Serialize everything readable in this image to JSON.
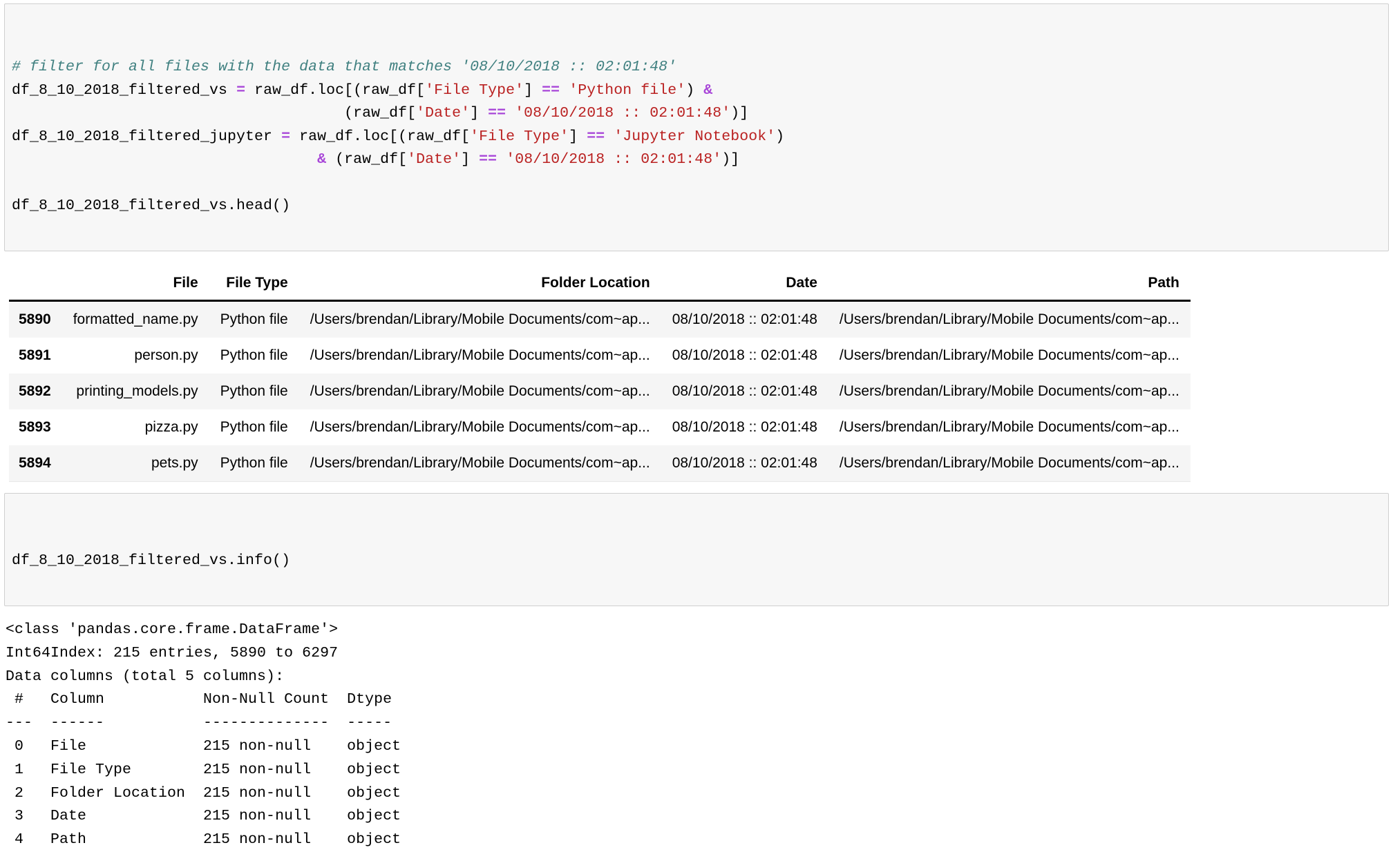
{
  "cell_1": {
    "name": "filter-code-cell",
    "lines": [
      [
        {
          "t": "comment",
          "v": "# filter for all files with the data that matches '08/10/2018 :: 02:01:48'"
        }
      ],
      [
        {
          "t": "plain",
          "v": "df_8_10_2018_filtered_vs "
        },
        {
          "t": "op",
          "v": "="
        },
        {
          "t": "plain",
          "v": " raw_df.loc[(raw_df["
        },
        {
          "t": "string",
          "v": "'File Type'"
        },
        {
          "t": "plain",
          "v": "] "
        },
        {
          "t": "op",
          "v": "=="
        },
        {
          "t": "plain",
          "v": " "
        },
        {
          "t": "string",
          "v": "'Python file'"
        },
        {
          "t": "plain",
          "v": ") "
        },
        {
          "t": "op",
          "v": "&"
        }
      ],
      [
        {
          "t": "plain",
          "v": "                                     (raw_df["
        },
        {
          "t": "string",
          "v": "'Date'"
        },
        {
          "t": "plain",
          "v": "] "
        },
        {
          "t": "op",
          "v": "=="
        },
        {
          "t": "plain",
          "v": " "
        },
        {
          "t": "string",
          "v": "'08/10/2018 :: 02:01:48'"
        },
        {
          "t": "plain",
          "v": ")]"
        }
      ],
      [
        {
          "t": "plain",
          "v": "df_8_10_2018_filtered_jupyter "
        },
        {
          "t": "op",
          "v": "="
        },
        {
          "t": "plain",
          "v": " raw_df.loc[(raw_df["
        },
        {
          "t": "string",
          "v": "'File Type'"
        },
        {
          "t": "plain",
          "v": "] "
        },
        {
          "t": "op",
          "v": "=="
        },
        {
          "t": "plain",
          "v": " "
        },
        {
          "t": "string",
          "v": "'Jupyter Notebook'"
        },
        {
          "t": "plain",
          "v": ")"
        }
      ],
      [
        {
          "t": "plain",
          "v": "                                  "
        },
        {
          "t": "op",
          "v": "&"
        },
        {
          "t": "plain",
          "v": " (raw_df["
        },
        {
          "t": "string",
          "v": "'Date'"
        },
        {
          "t": "plain",
          "v": "] "
        },
        {
          "t": "op",
          "v": "=="
        },
        {
          "t": "plain",
          "v": " "
        },
        {
          "t": "string",
          "v": "'08/10/2018 :: 02:01:48'"
        },
        {
          "t": "plain",
          "v": ")]"
        }
      ],
      [
        {
          "t": "plain",
          "v": ""
        }
      ],
      [
        {
          "t": "plain",
          "v": "df_8_10_2018_filtered_vs.head()"
        }
      ]
    ]
  },
  "dataframe": {
    "name": "filtered-vs-head-table",
    "columns": [
      "File",
      "File Type",
      "Folder Location",
      "Date",
      "Path"
    ],
    "index_name": "",
    "rows": [
      {
        "index": "5890",
        "File": "formatted_name.py",
        "File Type": "Python file",
        "Folder Location": "/Users/brendan/Library/Mobile Documents/com~ap...",
        "Date": "08/10/2018 :: 02:01:48",
        "Path": "/Users/brendan/Library/Mobile Documents/com~ap..."
      },
      {
        "index": "5891",
        "File": "person.py",
        "File Type": "Python file",
        "Folder Location": "/Users/brendan/Library/Mobile Documents/com~ap...",
        "Date": "08/10/2018 :: 02:01:48",
        "Path": "/Users/brendan/Library/Mobile Documents/com~ap..."
      },
      {
        "index": "5892",
        "File": "printing_models.py",
        "File Type": "Python file",
        "Folder Location": "/Users/brendan/Library/Mobile Documents/com~ap...",
        "Date": "08/10/2018 :: 02:01:48",
        "Path": "/Users/brendan/Library/Mobile Documents/com~ap..."
      },
      {
        "index": "5893",
        "File": "pizza.py",
        "File Type": "Python file",
        "Folder Location": "/Users/brendan/Library/Mobile Documents/com~ap...",
        "Date": "08/10/2018 :: 02:01:48",
        "Path": "/Users/brendan/Library/Mobile Documents/com~ap..."
      },
      {
        "index": "5894",
        "File": "pets.py",
        "File Type": "Python file",
        "Folder Location": "/Users/brendan/Library/Mobile Documents/com~ap...",
        "Date": "08/10/2018 :: 02:01:48",
        "Path": "/Users/brendan/Library/Mobile Documents/com~ap..."
      }
    ]
  },
  "cell_2": {
    "name": "info-code-cell",
    "source": "df_8_10_2018_filtered_vs.info()"
  },
  "info_output": {
    "name": "dataframe-info-output",
    "text": "<class 'pandas.core.frame.DataFrame'>\nInt64Index: 215 entries, 5890 to 6297\nData columns (total 5 columns):\n #   Column           Non-Null Count  Dtype \n---  ------           --------------  ----- \n 0   File             215 non-null    object\n 1   File Type        215 non-null    object\n 2   Folder Location  215 non-null    object\n 3   Date             215 non-null    object\n 4   Path             215 non-null    object"
  },
  "colors": {
    "comment": "#408080",
    "string": "#ba2121",
    "operator": "#a846d8",
    "cell_background": "#f7f7f7",
    "cell_border": "#cfcfcf",
    "row_stripe": "#f5f5f5",
    "header_rule": "#000000"
  }
}
